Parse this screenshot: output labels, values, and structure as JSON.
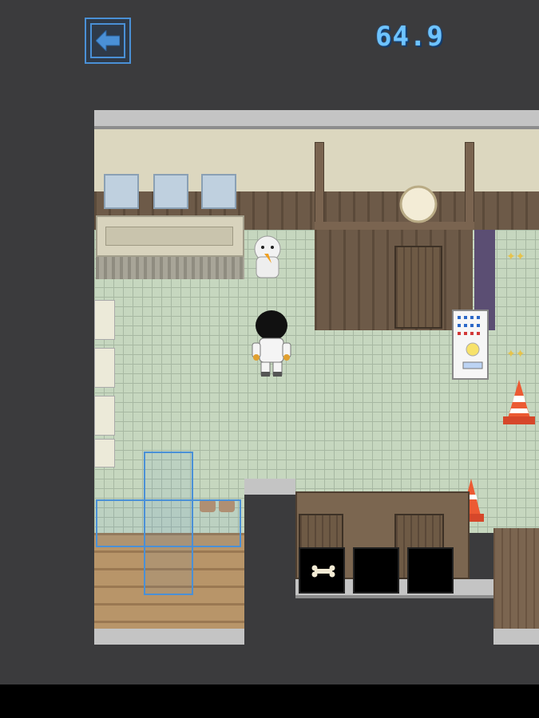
{
  "hud": {
    "timer": "64.9",
    "back_icon": "arrow-left-icon",
    "accent_color": "#4a90d6",
    "timer_color": "#6ec3ff"
  },
  "inventory": {
    "slots": [
      {
        "item": "bone-icon"
      },
      {
        "item": ""
      },
      {
        "item": ""
      }
    ]
  },
  "scene": {
    "description_icons": [
      "mirror-icon",
      "sink-icon",
      "dog-sprite",
      "player-sprite",
      "vending-machine",
      "traffic-cone",
      "wall-clock",
      "door",
      "urinal"
    ]
  }
}
